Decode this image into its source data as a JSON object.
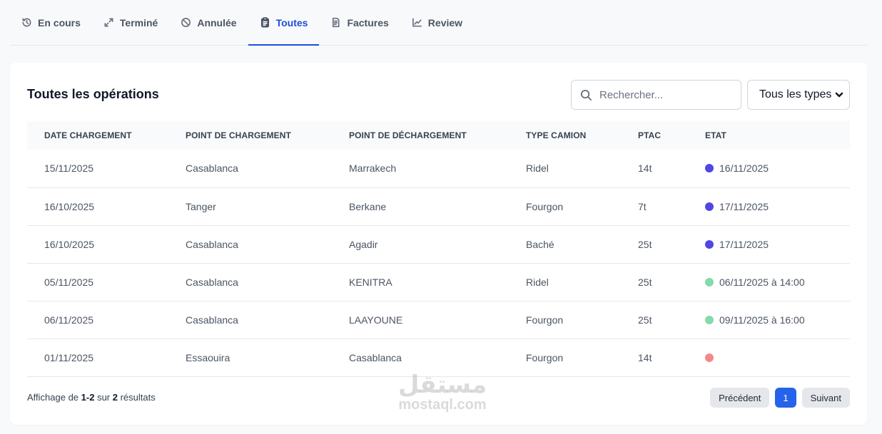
{
  "tabs": [
    {
      "label": "En cours",
      "icon": "history-icon"
    },
    {
      "label": "Terminé",
      "icon": "expand-icon"
    },
    {
      "label": "Annulée",
      "icon": "ban-icon"
    },
    {
      "label": "Toutes",
      "icon": "clipboard-icon",
      "active": true
    },
    {
      "label": "Factures",
      "icon": "invoice-icon"
    },
    {
      "label": "Review",
      "icon": "chart-line-icon"
    }
  ],
  "accent_color": "#1d4ed8",
  "card": {
    "title": "Toutes les opérations",
    "search_placeholder": "Rechercher...",
    "type_filter": "Tous les types"
  },
  "table": {
    "headers": [
      "DATE CHARGEMENT",
      "POINT DE CHARGEMENT",
      "POINT DE DÉCHARGEMENT",
      "TYPE CAMION",
      "PTAC",
      "ETAT"
    ],
    "rows": [
      {
        "date": "15/11/2025",
        "from": "Casablanca",
        "to": "Marrakech",
        "truck": "Ridel",
        "ptac": "14t",
        "status_color": "#4f46e5",
        "status_text": "16/11/2025"
      },
      {
        "date": "16/10/2025",
        "from": "Tanger",
        "to": "Berkane",
        "truck": "Fourgon",
        "ptac": "7t",
        "status_color": "#4f46e5",
        "status_text": "17/11/2025"
      },
      {
        "date": "16/10/2025",
        "from": "Casablanca",
        "to": "Agadir",
        "truck": "Baché",
        "ptac": "25t",
        "status_color": "#4f46e5",
        "status_text": "17/11/2025"
      },
      {
        "date": "05/11/2025",
        "from": "Casablanca",
        "to": "KENITRA",
        "truck": "Ridel",
        "ptac": "25t",
        "status_color": "#86d9a8",
        "status_text": "06/11/2025 à 14:00"
      },
      {
        "date": "06/11/2025",
        "from": "Casablanca",
        "to": "LAAYOUNE",
        "truck": "Fourgon",
        "ptac": "25t",
        "status_color": "#86d9a8",
        "status_text": "09/11/2025 à 16:00"
      },
      {
        "date": "01/11/2025",
        "from": "Essaouira",
        "to": "Casablanca",
        "truck": "Fourgon",
        "ptac": "14t",
        "status_color": "#f08a8a",
        "status_text": ""
      }
    ]
  },
  "footer": {
    "prefix": "Affichage de ",
    "range": "1-2",
    "middle": " sur ",
    "total": "2",
    "suffix": " résultats"
  },
  "pagination": {
    "prev_label": "Précédent",
    "current_page": "1",
    "next_label": "Suivant"
  },
  "watermark": {
    "arabic": "مستقل",
    "latin": "mostaql.com"
  }
}
